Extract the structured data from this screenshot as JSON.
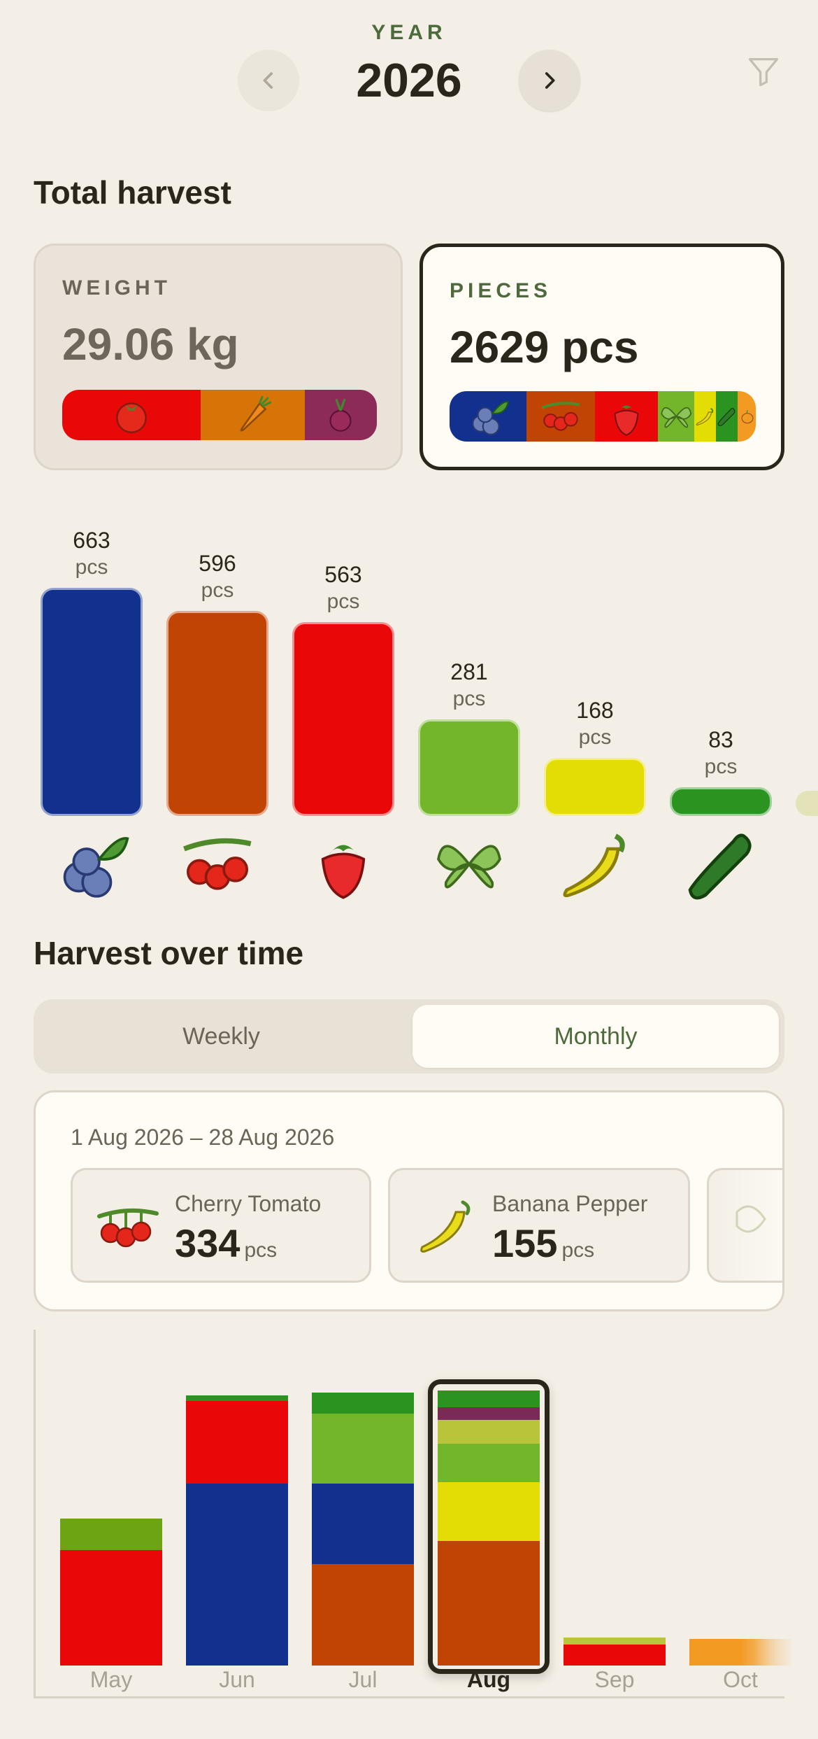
{
  "header": {
    "year_label": "YEAR",
    "year_value": "2026",
    "prev_icon": "chevron-left-icon",
    "next_icon": "chevron-right-icon",
    "filter_icon": "filter-icon"
  },
  "total_harvest": {
    "title": "Total harvest",
    "weight_card": {
      "label": "WEIGHT",
      "value": "29.06 kg",
      "segments": [
        {
          "icon": "tomato-icon",
          "color": "#e80808",
          "fraction": 0.44
        },
        {
          "icon": "carrot-icon",
          "color": "#d67408",
          "fraction": 0.33
        },
        {
          "icon": "beet-icon",
          "color": "#8d2b58",
          "fraction": 0.23
        }
      ]
    },
    "pieces_card": {
      "label": "PIECES",
      "value": "2629 pcs",
      "segments": [
        {
          "icon": "blueberry-icon",
          "color": "#12318e",
          "fraction": 0.25
        },
        {
          "icon": "cherry-tomato-icon",
          "color": "#c24405",
          "fraction": 0.225
        },
        {
          "icon": "strawberry-icon",
          "color": "#ea0708",
          "fraction": 0.205
        },
        {
          "icon": "mint-icon",
          "color": "#74b629",
          "fraction": 0.12
        },
        {
          "icon": "banana-pepper-icon",
          "color": "#e4dc05",
          "fraction": 0.07
        },
        {
          "icon": "cucumber-icon",
          "color": "#2b9420",
          "fraction": 0.07
        },
        {
          "icon": "pumpkin-icon",
          "color": "#f39a23",
          "fraction": 0.06
        }
      ]
    }
  },
  "chart_data": [
    {
      "type": "bar",
      "categories": [
        "Blueberry",
        "Cherry Tomato",
        "Strawberry",
        "Mint",
        "Banana Pepper",
        "Cucumber"
      ],
      "values": [
        663,
        596,
        563,
        281,
        168,
        83
      ],
      "value_labels": [
        "663",
        "596",
        "563",
        "281",
        "168",
        "83"
      ],
      "unit": "pcs",
      "colors": [
        "#12318e",
        "#c24405",
        "#ea0708",
        "#74b629",
        "#e4dc05",
        "#2b9420"
      ],
      "icons": [
        "blueberry-icon",
        "cherry-tomato-icon",
        "strawberry-icon",
        "mint-icon",
        "banana-pepper-icon",
        "cucumber-icon"
      ]
    },
    {
      "type": "bar",
      "stacked": true,
      "categories": [
        "May",
        "Jun",
        "Jul",
        "Aug",
        "Sep",
        "Oct"
      ],
      "selected": "Aug",
      "series": [
        {
          "color": "#c24405",
          "values": [
            0,
            0,
            145,
            178,
            0,
            0
          ]
        },
        {
          "color": "#12318e",
          "values": [
            0,
            260,
            115,
            0,
            0,
            0
          ]
        },
        {
          "color": "#ea0708",
          "values": [
            165,
            118,
            0,
            0,
            30,
            0
          ]
        },
        {
          "color": "#e4dc05",
          "values": [
            0,
            0,
            0,
            84,
            0,
            0
          ]
        },
        {
          "color": "#74b629",
          "values": [
            0,
            0,
            100,
            55,
            0,
            0
          ]
        },
        {
          "color": "#6ca414",
          "values": [
            45,
            0,
            0,
            0,
            0,
            0
          ]
        },
        {
          "color": "#b9c43a",
          "values": [
            0,
            0,
            0,
            34,
            10,
            0
          ]
        },
        {
          "color": "#7a2a56",
          "values": [
            0,
            0,
            0,
            18,
            0,
            0
          ]
        },
        {
          "color": "#2b9420",
          "values": [
            0,
            8,
            30,
            24,
            0,
            0
          ]
        },
        {
          "color": "#f39a23",
          "values": [
            0,
            0,
            0,
            0,
            0,
            38
          ]
        }
      ]
    }
  ],
  "harvest_over_time": {
    "title": "Harvest over time",
    "tabs": [
      {
        "label": "Weekly",
        "active": false
      },
      {
        "label": "Monthly",
        "active": true
      }
    ],
    "period": {
      "range": "1 Aug 2026 – 28 Aug 2026",
      "items": [
        {
          "icon": "cherry-tomato-icon",
          "name": "Cherry Tomato",
          "value": "334",
          "unit": "pcs"
        },
        {
          "icon": "banana-pepper-icon",
          "name": "Banana Pepper",
          "value": "155",
          "unit": "pcs"
        }
      ]
    }
  }
}
